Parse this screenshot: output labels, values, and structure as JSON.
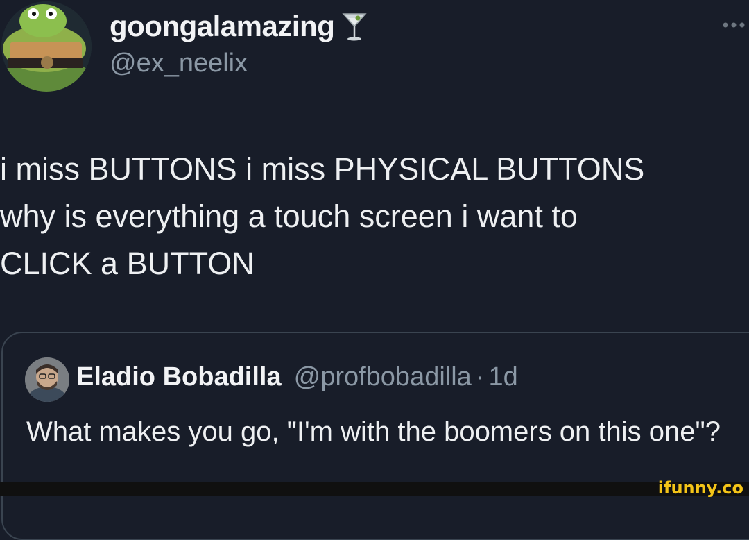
{
  "tweet": {
    "display_name": "goongalamazing",
    "handle": "@ex_neelix",
    "name_emoji": "cocktail-glass-icon",
    "text_lines": [
      "i miss BUTTONS i miss PHYSICAL BUTTONS",
      "why is everything a touch screen i want to",
      "CLICK a BUTTON"
    ]
  },
  "quote": {
    "display_name": "Eladio Bobadilla",
    "handle": "@profbobadilla",
    "separator": "·",
    "time": "1d",
    "text": "What makes you go, \"I'm with the boomers on this one\"?"
  },
  "watermark": "ifunny.co",
  "colors": {
    "background": "#181d29",
    "muted_text": "#8b98a5",
    "watermark": "#f5c518"
  }
}
